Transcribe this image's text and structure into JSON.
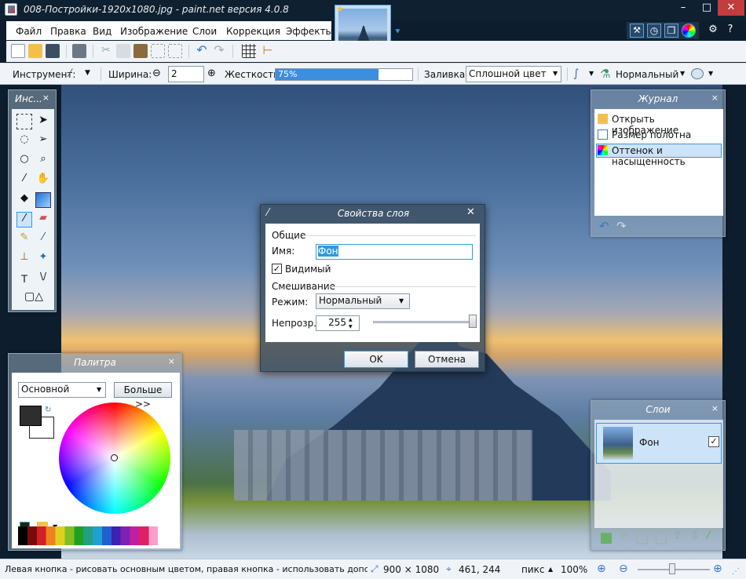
{
  "window": {
    "title": "008-Постройки-1920x1080.jpg - paint.net версия 4.0.8",
    "min": "–",
    "max": "□",
    "close": "✕",
    "settings": "⚙",
    "help": "?"
  },
  "menu": [
    "Файл",
    "Правка",
    "Вид",
    "Изображение",
    "Слои",
    "Коррекция",
    "Эффекты"
  ],
  "options": {
    "tool_label": "Инструмент:",
    "width_label": "Ширина:",
    "width_value": "2",
    "width_minus": "⊖",
    "width_plus": "⊕",
    "hardness_label": "Жесткость:",
    "hardness_value": "75%",
    "hardness": 0.75,
    "fill_label": "Заливка:",
    "fill_value": "Сплошной цвет",
    "blend_value": "Нормальный"
  },
  "tools_panel": {
    "title": "Инс...",
    "close": "×"
  },
  "history_panel": {
    "title": "Журнал",
    "close": "×",
    "items": [
      "Открыть изображение",
      "Размер полотна",
      "Оттенок и насыщенность"
    ]
  },
  "palette_panel": {
    "title": "Палитра",
    "close": "×",
    "select_value": "Основной",
    "more_button": "Больше >>"
  },
  "layers_panel": {
    "title": "Слои",
    "close": "×",
    "layer_name": "Фон",
    "checkmark": "✓"
  },
  "dialog": {
    "title": "Свойства слоя",
    "close": "✕",
    "general": "Общие",
    "name_label": "Имя:",
    "name_value": "Фон",
    "visible_label": "Видимый",
    "visible_check": "✓",
    "blending": "Смешивание",
    "mode_label": "Режим:",
    "mode_value": "Нормальный",
    "opacity_label": "Непрозр.:",
    "opacity_value": "255",
    "opacity": 1.0,
    "ok": "OK",
    "cancel": "Отмена"
  },
  "status": {
    "hint": "Левая кнопка - рисовать основным цветом, правая кнопка - использовать дополнительным цветом.",
    "size": "900 × 1080",
    "cursor": "461, 244",
    "units": "пикс",
    "zoom": "100%"
  },
  "colors": {
    "accent": "#3399dd",
    "titlebar": "#0f2030",
    "selection": "#cde3f7"
  }
}
